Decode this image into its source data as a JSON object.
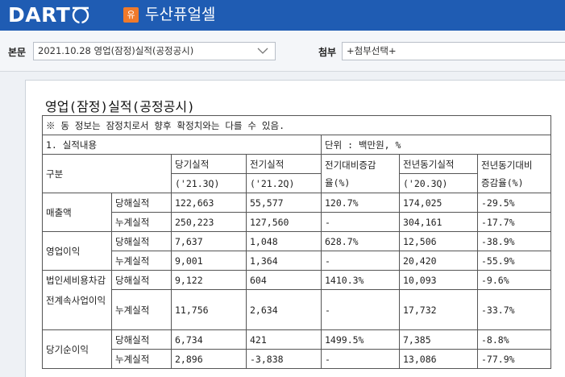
{
  "header": {
    "logo_text": "DART",
    "company_badge": "유",
    "company_name": "두산퓨얼셀"
  },
  "selectors": {
    "report_label": "본문",
    "report_value": "2021.10.28  영업(잠정)실적(공정공시)",
    "attach_label": "첨부",
    "attach_value": "+첨부선택+"
  },
  "document": {
    "title": "영업(잠정)실적(공정공시)",
    "notice": "※ 동 정보는 잠정치로서 향후 확정치와는 다를 수 있음.",
    "section": "1. 실적내용",
    "unit": "단위 : 백만원, %",
    "headers": {
      "category": "구분",
      "current_period": "당기실적",
      "current_period_sub": "('21.3Q)",
      "previous_period": "전기실적",
      "previous_period_sub": "('21.2Q)",
      "prev_change": "전기대비증감",
      "prev_change_sub": "율(%)",
      "yoy_period": "전년동기실적",
      "yoy_period_sub": "('20.3Q)",
      "yoy_change": "전년동기대비",
      "yoy_change_sub": "증감율(%)"
    },
    "rows": [
      {
        "item": "매출액",
        "quarter": {
          "type": "당해실적",
          "current": "122,663",
          "previous": "55,577",
          "prev_change": "120.7%",
          "yoy": "174,025",
          "yoy_change": "-29.5%"
        },
        "cumulative": {
          "type": "누계실적",
          "current": "250,223",
          "previous": "127,560",
          "prev_change": "-",
          "yoy": "304,161",
          "yoy_change": "-17.7%"
        }
      },
      {
        "item": "영업이익",
        "quarter": {
          "type": "당해실적",
          "current": "7,637",
          "previous": "1,048",
          "prev_change": "628.7%",
          "yoy": "12,506",
          "yoy_change": "-38.9%"
        },
        "cumulative": {
          "type": "누계실적",
          "current": "9,001",
          "previous": "1,364",
          "prev_change": "-",
          "yoy": "20,420",
          "yoy_change": "-55.9%"
        }
      },
      {
        "item": "법인세비용차감전계속사업이익",
        "quarter": {
          "type": "당해실적",
          "current": "9,122",
          "previous": "604",
          "prev_change": "1410.3%",
          "yoy": "10,093",
          "yoy_change": "-9.6%"
        },
        "cumulative": {
          "type": "누계실적",
          "current": "11,756",
          "previous": "2,634",
          "prev_change": "-",
          "yoy": "17,732",
          "yoy_change": "-33.7%"
        }
      },
      {
        "item": "당기순이익",
        "quarter": {
          "type": "당해실적",
          "current": "6,734",
          "previous": "421",
          "prev_change": "1499.5%",
          "yoy": "7,385",
          "yoy_change": "-8.8%"
        },
        "cumulative": {
          "type": "누계실적",
          "current": "2,896",
          "previous": "-3,838",
          "prev_change": "-",
          "yoy": "13,086",
          "yoy_change": "-77.9%"
        }
      }
    ]
  }
}
